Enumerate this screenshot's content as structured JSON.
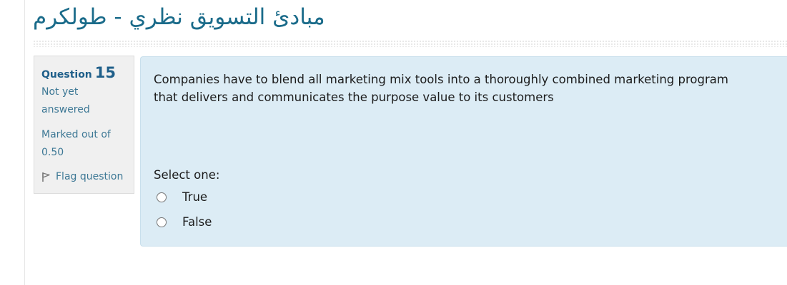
{
  "course": {
    "title": "مبادئ التسويق نظري - طولكرم"
  },
  "question_info": {
    "label": "Question",
    "number": "15",
    "state": [
      "Not yet",
      "answered"
    ],
    "mark": [
      "Marked out of",
      "0.50"
    ],
    "flag_label": "Flag question",
    "flag_icon": "flag-icon"
  },
  "question": {
    "text_lines": [
      "Companies have to blend all marketing mix tools into a thoroughly combined marketing program",
      "that delivers and communicates the purpose value to its customers"
    ],
    "prompt": "Select one:",
    "options": [
      {
        "label": "True",
        "selected": false
      },
      {
        "label": "False",
        "selected": false
      }
    ]
  },
  "colors": {
    "accent": "#1a6b8a",
    "info_panel_bg": "#f0f0f0",
    "content_panel_bg": "#dcecf5"
  }
}
